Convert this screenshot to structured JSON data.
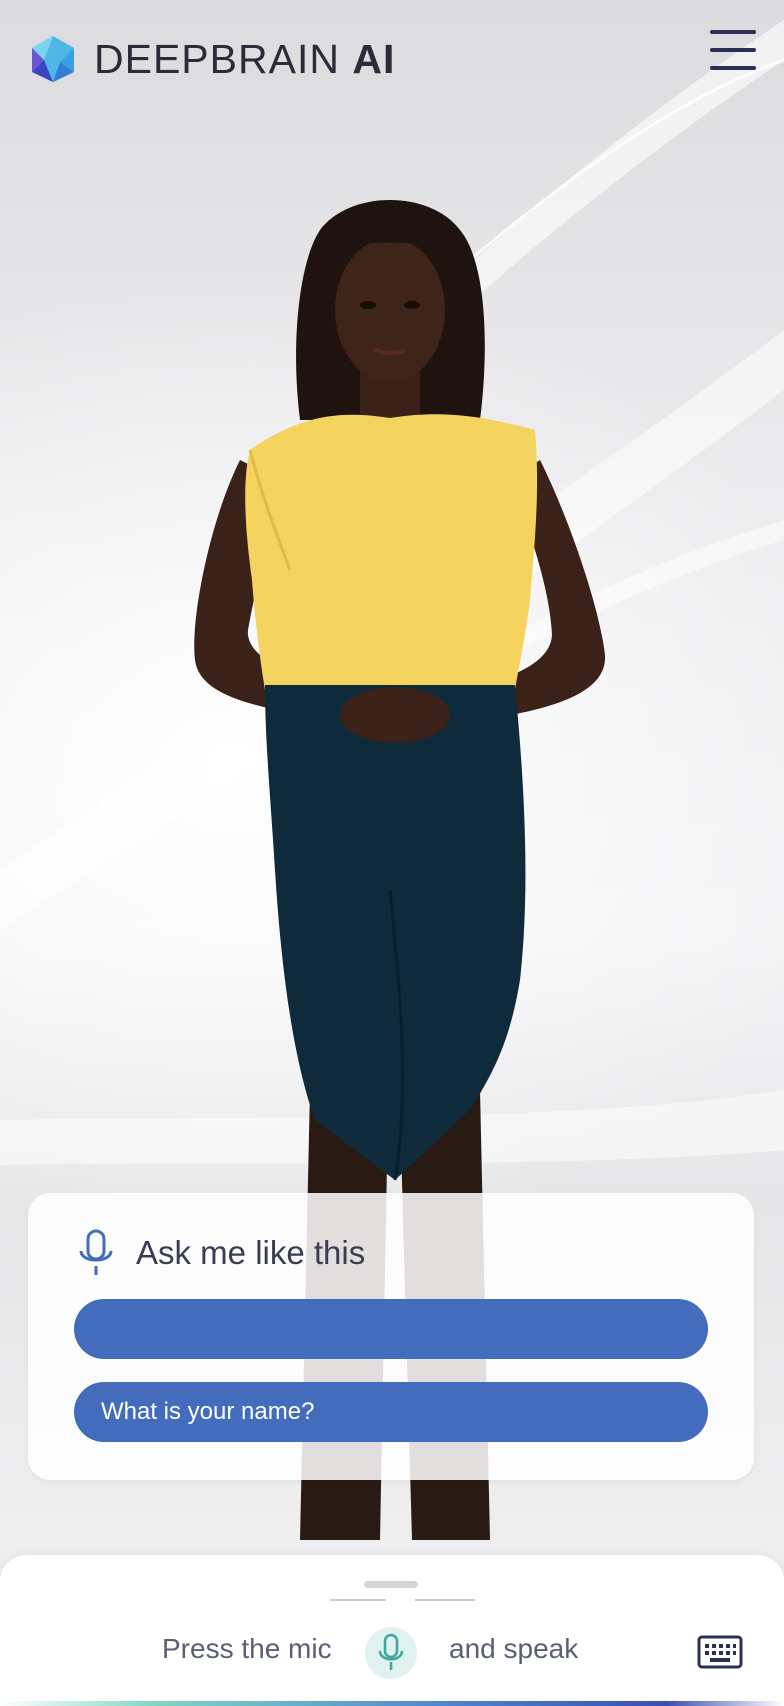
{
  "header": {
    "brand_primary": "DEEPBRAIN ",
    "brand_bold": "AI",
    "menu_icon": "hamburger-menu-icon"
  },
  "avatar": {
    "description_icon": "ai-human-avatar"
  },
  "suggestions": {
    "title": "Ask me like this",
    "icon": "microphone-icon",
    "items": [
      {
        "label": ""
      },
      {
        "label": "What is your name?"
      }
    ]
  },
  "bottom_bar": {
    "prompt_before": "Press the mic",
    "prompt_after": "and speak",
    "mic_icon": "microphone-icon",
    "keyboard_icon": "keyboard-icon"
  },
  "colors": {
    "accent": "#436cbd",
    "brand_text": "#2b2b3a",
    "menu": "#2b2f55",
    "mic_bg": "#dff2ef",
    "mic_stroke": "#3fa9a0"
  }
}
